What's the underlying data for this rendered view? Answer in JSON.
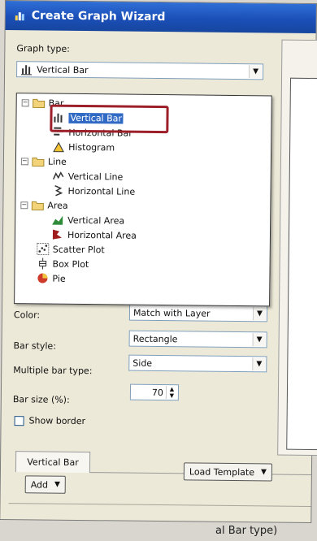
{
  "window": {
    "title": "Create Graph Wizard"
  },
  "graph_type": {
    "label": "Graph type:",
    "selected": "Vertical Bar",
    "tree": [
      {
        "label": "Bar",
        "children": [
          "Vertical Bar",
          "Horizontal Bar",
          "Histogram"
        ]
      },
      {
        "label": "Line",
        "children": [
          "Vertical Line",
          "Horizontal Line"
        ]
      },
      {
        "label": "Area",
        "children": [
          "Vertical Area",
          "Horizontal Area"
        ]
      },
      {
        "label": "Scatter Plot"
      },
      {
        "label": "Box Plot"
      },
      {
        "label": "Pie"
      }
    ]
  },
  "properties": {
    "color_label": "Color:",
    "color_value": "Match with Layer",
    "bar_style_label": "Bar style:",
    "bar_style_value": "Rectangle",
    "multiple_bar_type_label": "Multiple bar type:",
    "multiple_bar_type_value": "Side",
    "bar_size_label": "Bar size (%):",
    "bar_size_value": "70",
    "show_border_label": "Show border"
  },
  "tabs": [
    {
      "label": "Vertical Bar"
    }
  ],
  "buttons": {
    "load_template": "Load Template",
    "add": "Add"
  },
  "caption_fragment": "al Bar type)",
  "colors": {
    "title_bar": "#1b4fb8",
    "selection": "#316ac5",
    "annotation": "#9c1f2a"
  }
}
